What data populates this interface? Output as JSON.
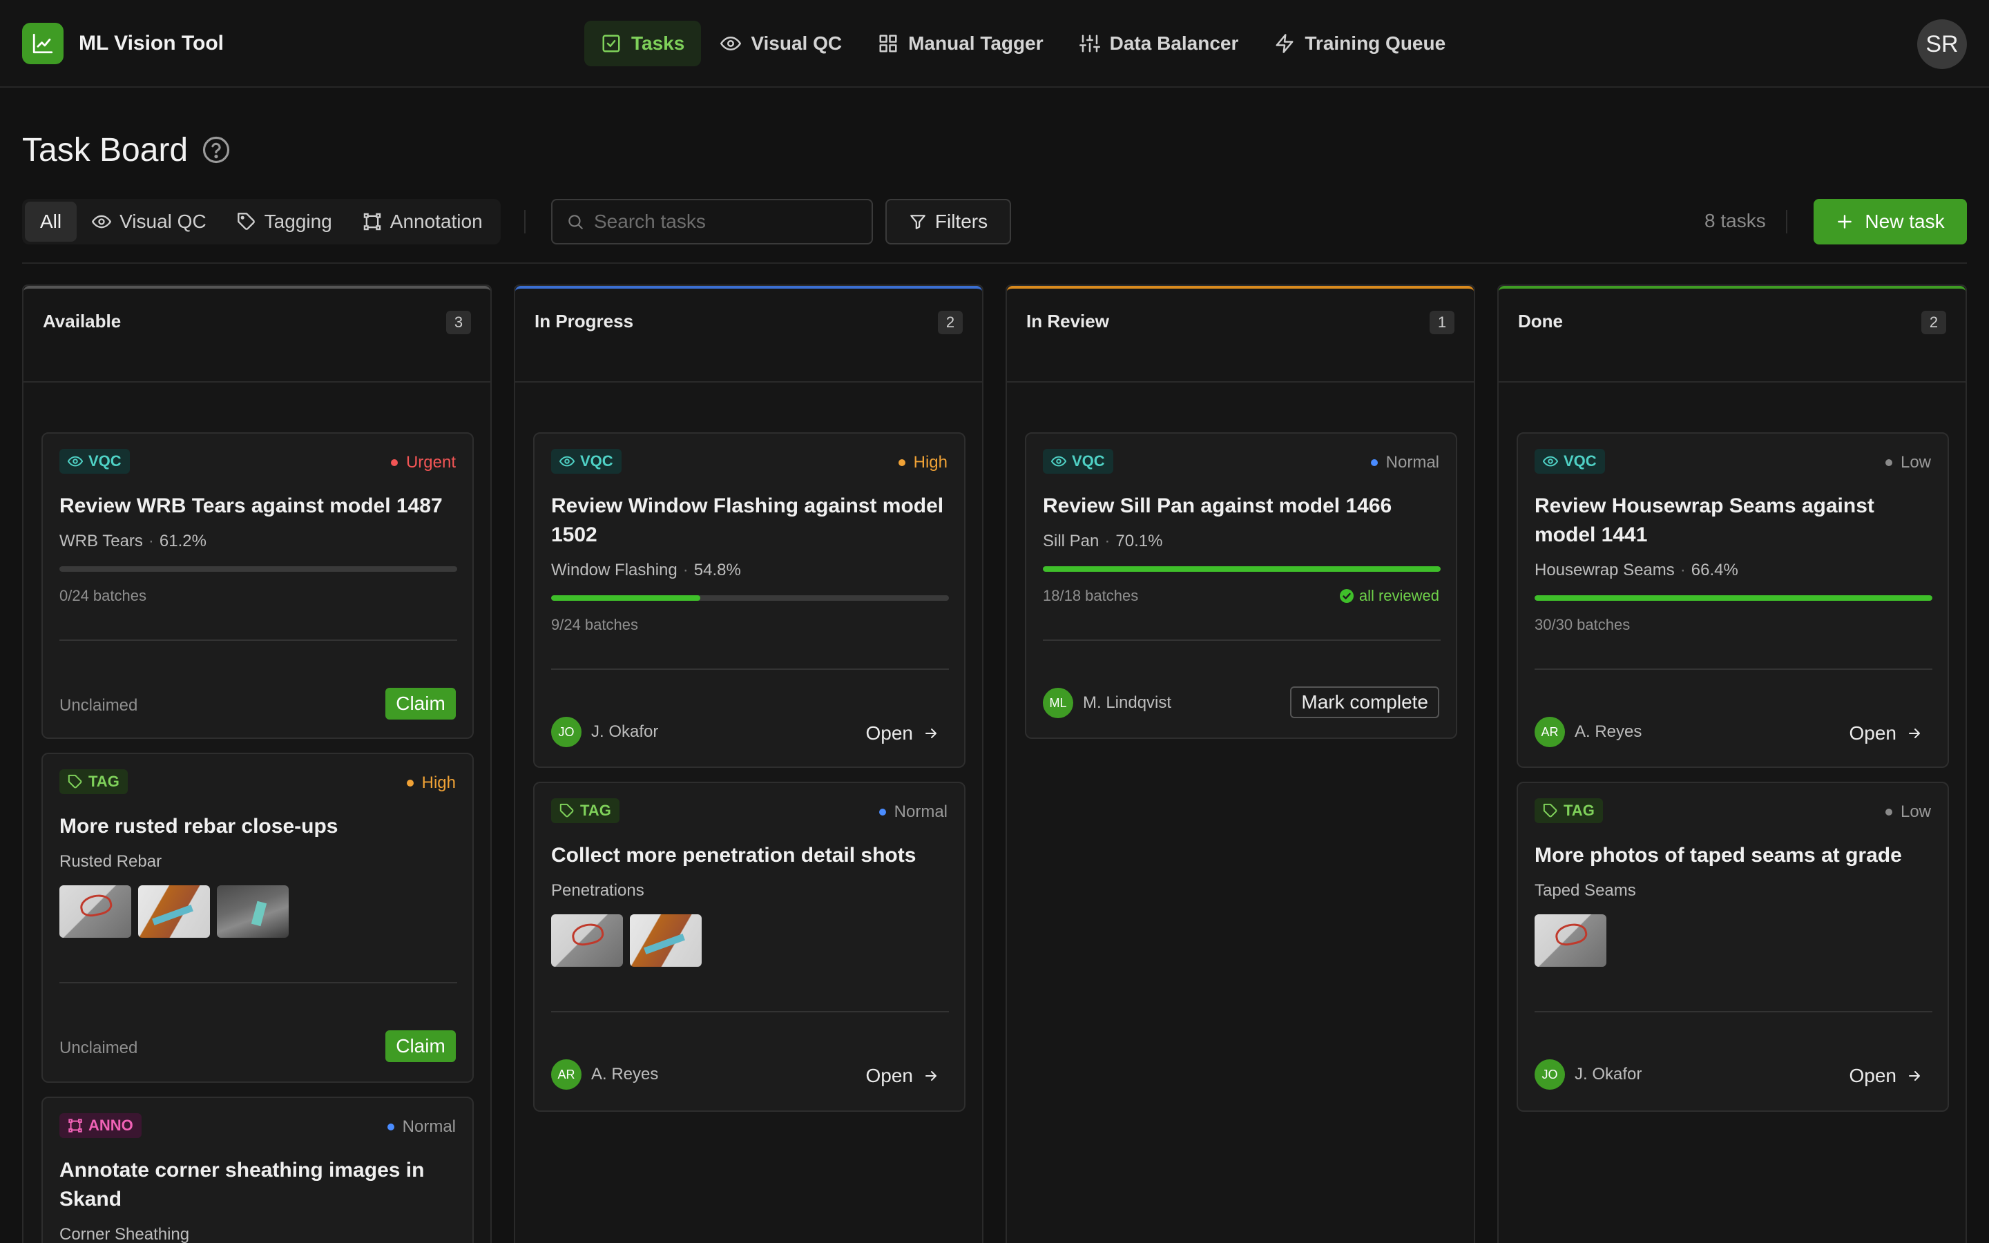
{
  "app": {
    "name": "ML Vision Tool",
    "user_initials": "SR"
  },
  "nav": [
    {
      "label": "Tasks",
      "icon": "check-square-icon",
      "active": true
    },
    {
      "label": "Visual QC",
      "icon": "eye-icon"
    },
    {
      "label": "Manual Tagger",
      "icon": "grid-icon"
    },
    {
      "label": "Data Balancer",
      "icon": "sliders-icon"
    },
    {
      "label": "Training Queue",
      "icon": "zap-icon"
    }
  ],
  "page": {
    "title": "Task Board"
  },
  "filters": {
    "segments": [
      {
        "label": "All",
        "active": true
      },
      {
        "label": "Visual QC",
        "icon": "eye-icon"
      },
      {
        "label": "Tagging",
        "icon": "tag-icon"
      },
      {
        "label": "Annotation",
        "icon": "frame-icon"
      }
    ],
    "search_placeholder": "Search tasks",
    "filters_label": "Filters",
    "task_count": "8 tasks",
    "new_task_label": "New task"
  },
  "columns": [
    {
      "title": "Available",
      "count": "3",
      "accent": "#555555",
      "cards": [
        {
          "badge": "VQC",
          "priority": "Urgent",
          "title": "Review WRB Tears against model 1487",
          "subject": "WRB Tears",
          "score": "61.2%",
          "progress": 0.0,
          "batches": "0/24 batches",
          "status": "Unclaimed",
          "action": "Claim"
        },
        {
          "badge": "TAG",
          "priority": "High",
          "title": "More rusted rebar close-ups",
          "subject": "Rusted Rebar",
          "status": "Unclaimed",
          "action": "Claim"
        },
        {
          "badge": "ANNO",
          "priority": "Normal",
          "title": "Annotate corner sheathing images in Skand",
          "subject": "Corner Sheathing"
        }
      ]
    },
    {
      "title": "In Progress",
      "count": "2",
      "accent": "#3b6fd1",
      "cards": [
        {
          "badge": "VQC",
          "priority": "High",
          "title": "Review Window Flashing against model 1502",
          "subject": "Window Flashing",
          "score": "54.8%",
          "progress": 0.375,
          "batches": "9/24 batches",
          "assignee_initials": "JO",
          "assignee": "J. Okafor",
          "action": "Open"
        },
        {
          "badge": "TAG",
          "priority": "Normal",
          "title": "Collect more penetration detail shots",
          "subject": "Penetrations",
          "assignee_initials": "AR",
          "assignee": "A. Reyes",
          "action": "Open"
        }
      ]
    },
    {
      "title": "In Review",
      "count": "1",
      "accent": "#d98a1e",
      "cards": [
        {
          "badge": "VQC",
          "priority": "Normal",
          "title": "Review Sill Pan against model 1466",
          "subject": "Sill Pan",
          "score": "70.1%",
          "progress": 1.0,
          "batches": "18/18 batches",
          "reviewed": "all reviewed",
          "assignee_initials": "ML",
          "assignee": "M. Lindqvist",
          "action": "Mark complete"
        }
      ]
    },
    {
      "title": "Done",
      "count": "2",
      "accent": "#3f9c24",
      "cards": [
        {
          "badge": "VQC",
          "priority": "Low",
          "title": "Review Housewrap Seams against model 1441",
          "subject": "Housewrap Seams",
          "score": "66.4%",
          "progress": 1.0,
          "batches": "30/30 batches",
          "assignee_initials": "AR",
          "assignee": "A. Reyes",
          "action": "Open"
        },
        {
          "badge": "TAG",
          "priority": "Low",
          "title": "More photos of taped seams at grade",
          "subject": "Taped Seams",
          "assignee_initials": "JO",
          "assignee": "J. Okafor",
          "action": "Open"
        }
      ]
    }
  ]
}
